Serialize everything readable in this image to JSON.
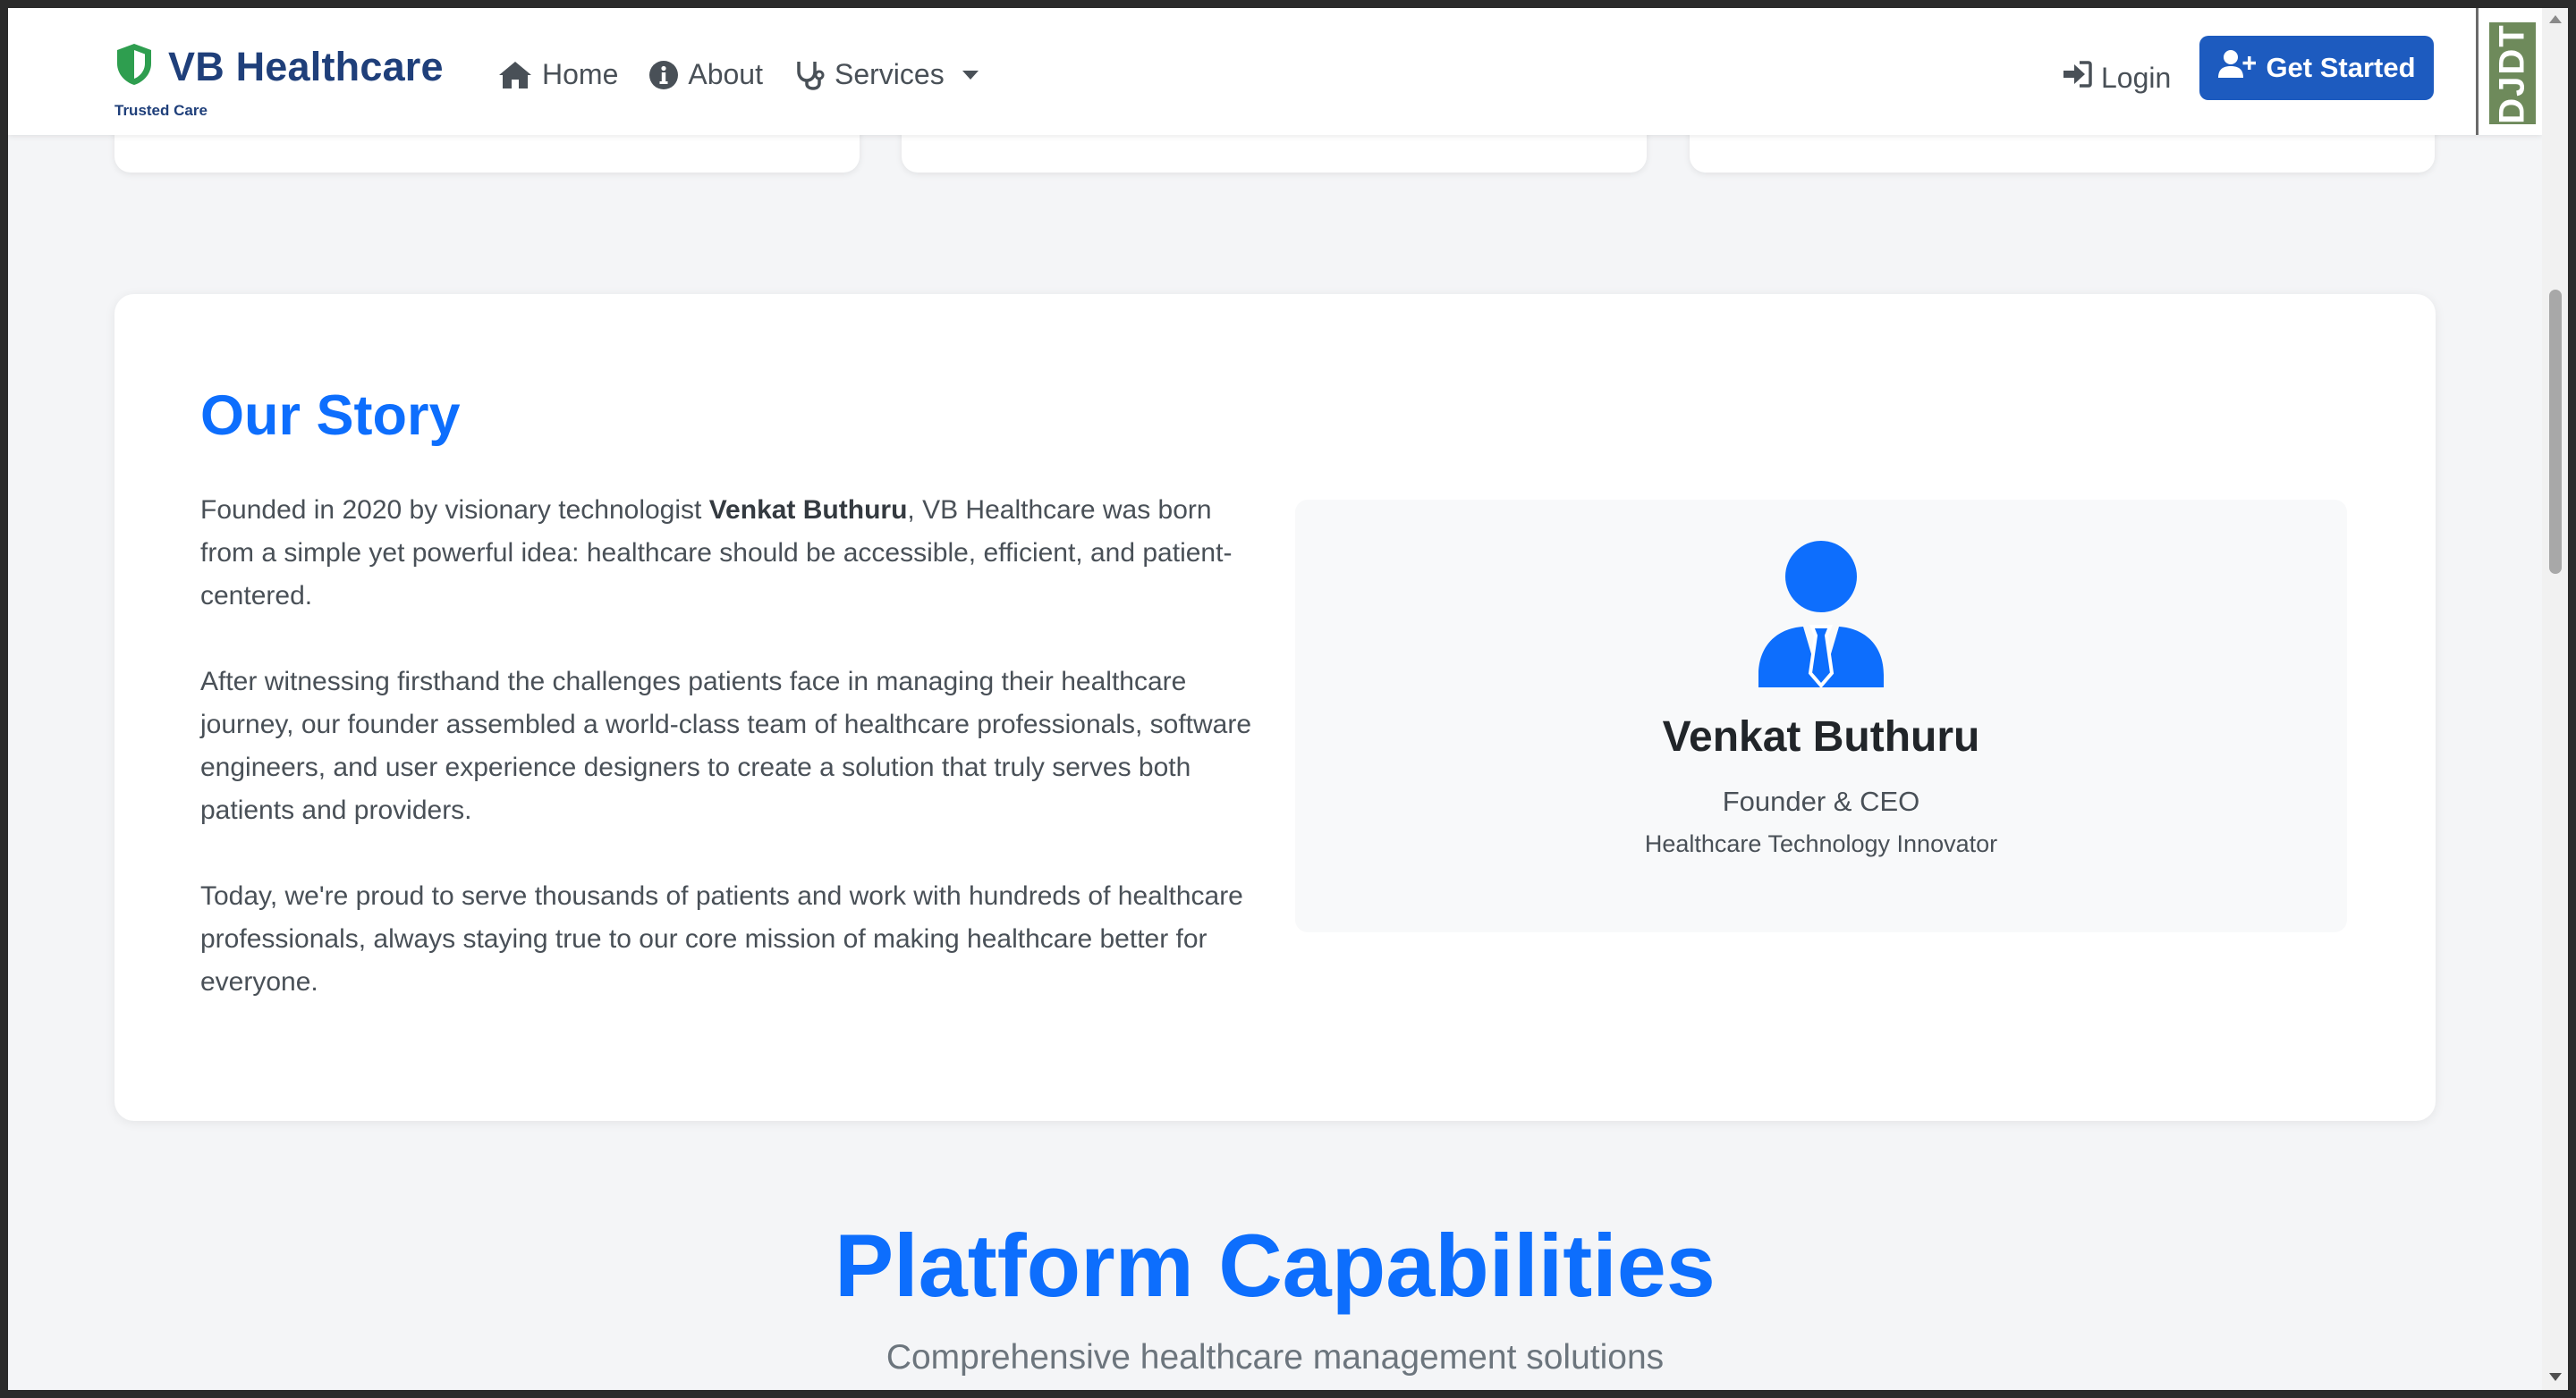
{
  "navbar": {
    "brand_name": "VB Healthcare",
    "brand_tagline": "Trusted Care",
    "links": [
      {
        "label": "Home",
        "icon": "home-icon"
      },
      {
        "label": "About",
        "icon": "info-circle-icon"
      },
      {
        "label": "Services",
        "icon": "stethoscope-icon"
      }
    ],
    "login_label": "Login",
    "cta_label": "Get Started"
  },
  "debug_toolbar": {
    "label": "DJDT"
  },
  "story": {
    "title": "Our Story",
    "p1_before": "Founded in 2020 by visionary technologist ",
    "p1_bold": "Venkat Buthuru",
    "p1_after": ", VB Healthcare was born from a simple yet powerful idea: healthcare should be accessible, efficient, and patient-centered.",
    "p2": "After witnessing firsthand the challenges patients face in managing their healthcare journey, our founder assembled a world-class team of healthcare professionals, software engineers, and user experience designers to create a solution that truly serves both patients and providers.",
    "p3": "Today, we're proud to serve thousands of patients and work with hundreds of healthcare professionals, always staying true to our core mission of making healthcare better for everyone."
  },
  "founder": {
    "name": "Venkat Buthuru",
    "role": "Founder & CEO",
    "subtitle": "Healthcare Technology Innovator",
    "icon": "user-tie-icon"
  },
  "capabilities": {
    "title": "Platform Capabilities",
    "subtitle": "Comprehensive healthcare management solutions"
  },
  "colors": {
    "primary": "#0d6efd",
    "brand": "#1f3f7a",
    "cta": "#1d5bbf",
    "shield": "#2e9e4f"
  }
}
